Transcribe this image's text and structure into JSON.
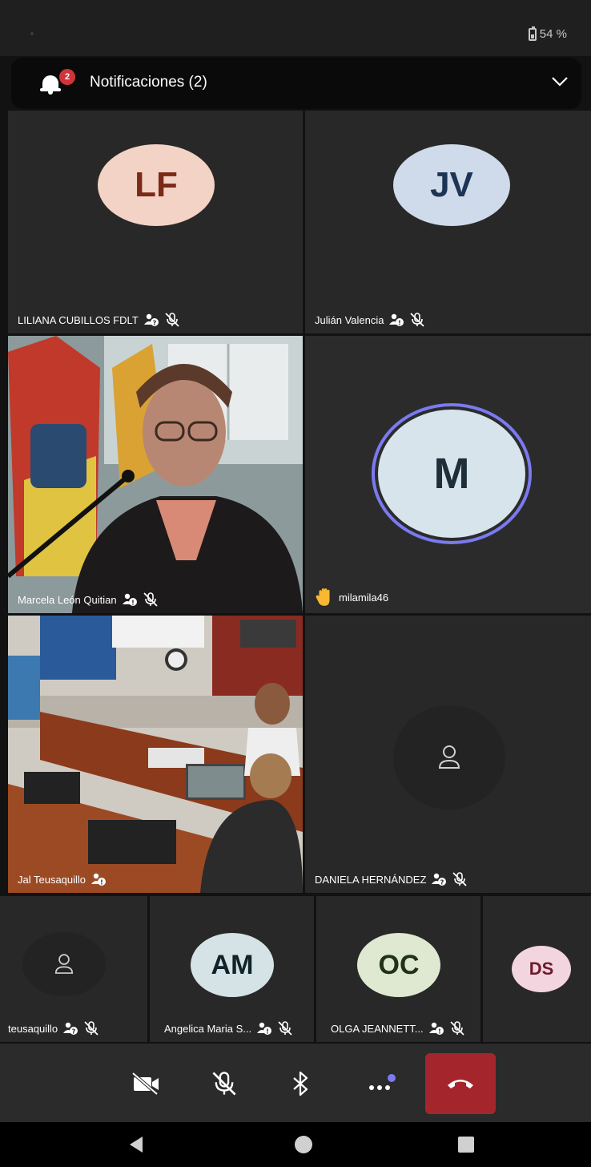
{
  "status_bar": {
    "battery": "54 %"
  },
  "notification": {
    "title": "Notificaciones (2)",
    "badge": "2"
  },
  "participants": {
    "lf": {
      "initials": "LF",
      "name": "LILIANA CUBILLOS FDLT"
    },
    "jv": {
      "initials": "JV",
      "name": "Julián Valencia"
    },
    "marcela": {
      "name": "Marcela León Quitian"
    },
    "m": {
      "initials": "M",
      "name": "milamila46",
      "hand_raised": true
    },
    "jal": {
      "name": "Jal Teusaquillo"
    },
    "daniela": {
      "name": "DANIELA HERNÁNDEZ"
    },
    "teusaquillo": {
      "name": "teusaquillo"
    },
    "am": {
      "initials": "AM",
      "name": "Angelica Maria S..."
    },
    "oc": {
      "initials": "OC",
      "name": "OLGA JEANNETT..."
    },
    "ds": {
      "initials": "DS"
    }
  },
  "colors": {
    "lf_bg": "#f3d3c5",
    "lf_fg": "#7a2a17",
    "jv_bg": "#cfdbea",
    "jv_fg": "#1c3556",
    "m_bg": "#d8e4ec",
    "m_fg": "#1e2f3a",
    "m_ring": "#7b7af0",
    "am_bg": "#d5e2e6",
    "am_fg": "#10232b",
    "oc_bg": "#dfe9d2",
    "oc_fg": "#22311a",
    "ds_bg": "#f2d5de",
    "ds_fg": "#6d1a2f",
    "end_call": "#a4262c"
  },
  "toolbar": {
    "camera": "camera-off-icon",
    "mic": "mic-off-icon",
    "bluetooth": "bluetooth-icon",
    "more": "more-icon",
    "end": "end-call-icon"
  }
}
